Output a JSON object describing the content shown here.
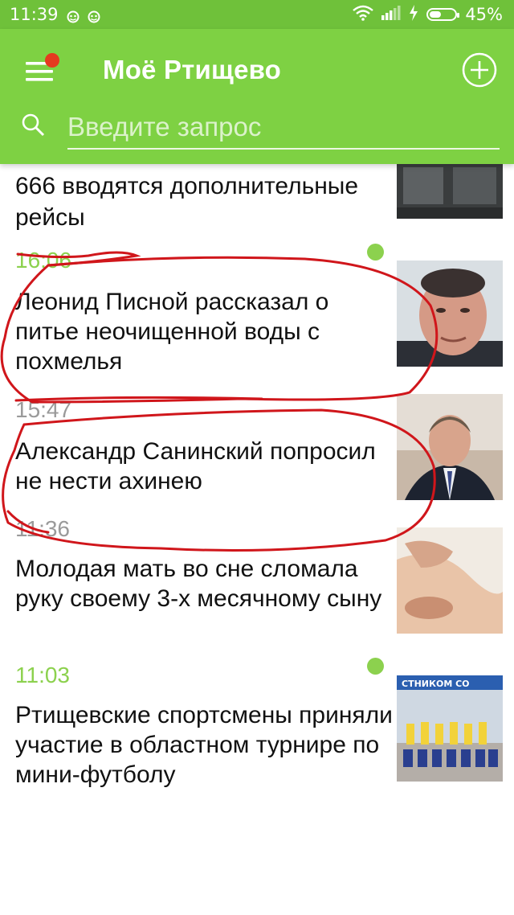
{
  "status_bar": {
    "time": "11:39",
    "notification_icons": [
      "face-icon",
      "face-icon"
    ],
    "system_icons": [
      "wifi-icon",
      "signal-icon",
      "charging-icon",
      "battery-icon"
    ],
    "battery_percent": "45%",
    "battery_level": 0.45
  },
  "app_bar": {
    "title": "Моё Ртищево",
    "menu_has_badge": true,
    "search_placeholder": "Введите запрос",
    "search_value": ""
  },
  "colors": {
    "status_bar": "#6fc13a",
    "app_bar": "#7ed143",
    "fresh_time": "#8cd14e",
    "old_time": "#9a9a9a",
    "badge": "#e53a1f",
    "annotation": "#d0161b"
  },
  "feed": [
    {
      "time": "",
      "headline": "666 вводятся дополнительные рейсы",
      "is_new": false,
      "thumb": "bus-window-photo"
    },
    {
      "time": "16:06",
      "headline": "Леонид Писной рассказал о питье неочищенной воды с похмелья",
      "is_new": true,
      "thumb": "man-portrait-photo"
    },
    {
      "time": "15:47",
      "headline": "Александр Санинский попросил не нести ахинею",
      "is_new": false,
      "thumb": "man-in-suit-photo"
    },
    {
      "time": "11:36",
      "headline": "Молодая мать во сне сломала руку своему 3-х месячному сыну",
      "is_new": false,
      "thumb": "baby-hand-photo"
    },
    {
      "time": "11:03",
      "headline": "Ртищевские спортсмены приняли участие в областном турнире по мини-футболу",
      "is_new": true,
      "thumb": "football-team-photo"
    }
  ]
}
